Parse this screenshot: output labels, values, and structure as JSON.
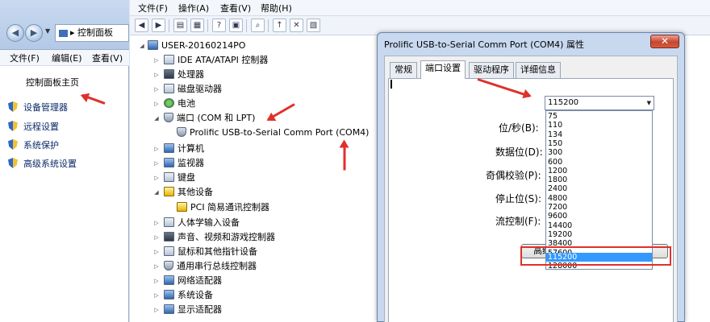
{
  "control_panel": {
    "breadcrumb": "控制面板",
    "menu": [
      "文件(F)",
      "编辑(E)",
      "查看(V)"
    ],
    "home_label": "控制面板主页",
    "links": [
      "设备管理器",
      "远程设置",
      "系统保护",
      "高级系统设置"
    ]
  },
  "device_manager": {
    "menu": [
      "文件(F)",
      "操作(A)",
      "查看(V)",
      "帮助(H)"
    ],
    "toolbar_icons": [
      "back-icon",
      "forward-icon",
      "list-icon",
      "properties-icon",
      "help-icon",
      "refresh-icon",
      "update-driver-icon",
      "uninstall-icon",
      "scan-icon"
    ],
    "root_node": "USER-20160214PO",
    "tree": [
      {
        "label": "IDE ATA/ATAPI 控制器",
        "icon": "ide-controller-icon"
      },
      {
        "label": "处理器",
        "icon": "processor-icon"
      },
      {
        "label": "磁盘驱动器",
        "icon": "disk-drive-icon"
      },
      {
        "label": "电池",
        "icon": "battery-icon"
      },
      {
        "label": "端口 (COM 和 LPT)",
        "icon": "port-icon"
      },
      {
        "label": "Prolific USB-to-Serial Comm Port (COM4)",
        "icon": "serial-port-icon"
      },
      {
        "label": "计算机",
        "icon": "computer-icon"
      },
      {
        "label": "监视器",
        "icon": "monitor-icon"
      },
      {
        "label": "键盘",
        "icon": "keyboard-icon"
      },
      {
        "label": "其他设备",
        "icon": "other-devices-icon"
      },
      {
        "label": "PCI 简易通讯控制器",
        "icon": "warning-device-icon"
      },
      {
        "label": "人体学输入设备",
        "icon": "hid-icon"
      },
      {
        "label": "声音、视频和游戏控制器",
        "icon": "sound-icon"
      },
      {
        "label": "鼠标和其他指针设备",
        "icon": "mouse-icon"
      },
      {
        "label": "通用串行总线控制器",
        "icon": "usb-icon"
      },
      {
        "label": "网络适配器",
        "icon": "network-icon"
      },
      {
        "label": "系统设备",
        "icon": "system-device-icon"
      },
      {
        "label": "显示适配器",
        "icon": "display-adapter-icon"
      }
    ]
  },
  "dialog": {
    "title": "Prolific USB-to-Serial Comm Port (COM4) 属性",
    "close_label": "✕",
    "tabs": [
      "常规",
      "端口设置",
      "驱动程序",
      "详细信息"
    ],
    "active_tab": "端口设置",
    "fields": [
      "位/秒(B):",
      "数据位(D):",
      "奇偶校验(P):",
      "停止位(S):",
      "流控制(F):"
    ],
    "selected_rate": "115200",
    "rate_options": [
      "75",
      "110",
      "134",
      "150",
      "300",
      "600",
      "1200",
      "1800",
      "2400",
      "4800",
      "7200",
      "9600",
      "14400",
      "19200",
      "38400",
      "57600",
      "115200",
      "128000"
    ],
    "advanced_button": "高级(A)..."
  },
  "colors": {
    "annotation": "#e0302b",
    "selection": "#3399ff"
  }
}
